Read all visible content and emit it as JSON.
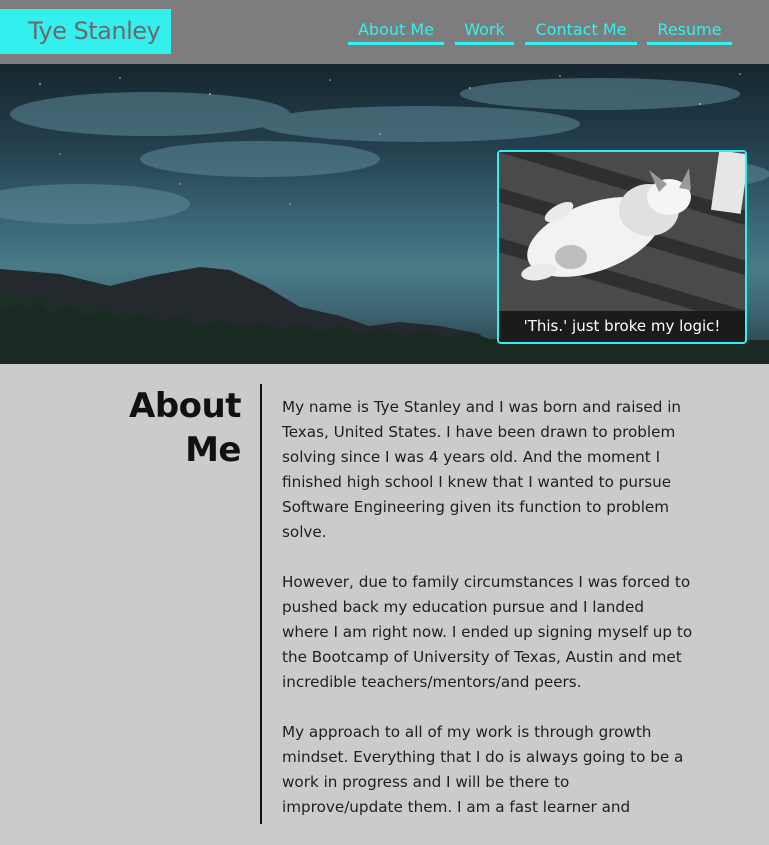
{
  "header": {
    "logo": "Tye Stanley",
    "nav": [
      "About Me",
      "Work",
      "Contact Me",
      "Resume"
    ]
  },
  "hero": {
    "photo_caption": "'This.' just broke my logic!"
  },
  "about": {
    "title": "About Me",
    "paragraphs": [
      "My name is Tye Stanley and I was born and raised in Texas, United States. I have been drawn to problem solving since I was 4 years old. And the moment I finished high school I knew that I wanted to pursue Software Engineering given its function to problem solve.",
      "However, due to family circumstances I was forced to pushed back my education pursue and I landed where I am right now. I ended up signing myself up to the Bootcamp of University of Texas, Austin and met incredible teachers/mentors/and peers.",
      "My approach to all of my work is through growth mindset. Everything that I do is always going to be a work in progress and I will be there to improve/update them. I am a fast learner and"
    ]
  },
  "colors": {
    "accent": "#33f0ef",
    "header_bg": "#7d7d7d",
    "page_bg": "#cbcbcb"
  }
}
